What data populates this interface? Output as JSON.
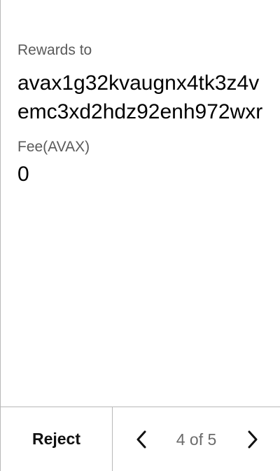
{
  "transaction": {
    "rewards_label": "Rewards to",
    "rewards_address": "avax1g32kvaugnx4tk3z4vemc3xd2hdz92enh972wxr",
    "fee_label": "Fee(AVAX)",
    "fee_value": "0"
  },
  "footer": {
    "reject_label": "Reject",
    "page_indicator": "4 of 5",
    "prev_icon": "chevron-left-icon",
    "next_icon": "chevron-right-icon"
  },
  "colors": {
    "label": "#5a5a5a",
    "value": "#000000",
    "divider": "#b8b8b8",
    "pager_text": "#6b6b6b"
  }
}
